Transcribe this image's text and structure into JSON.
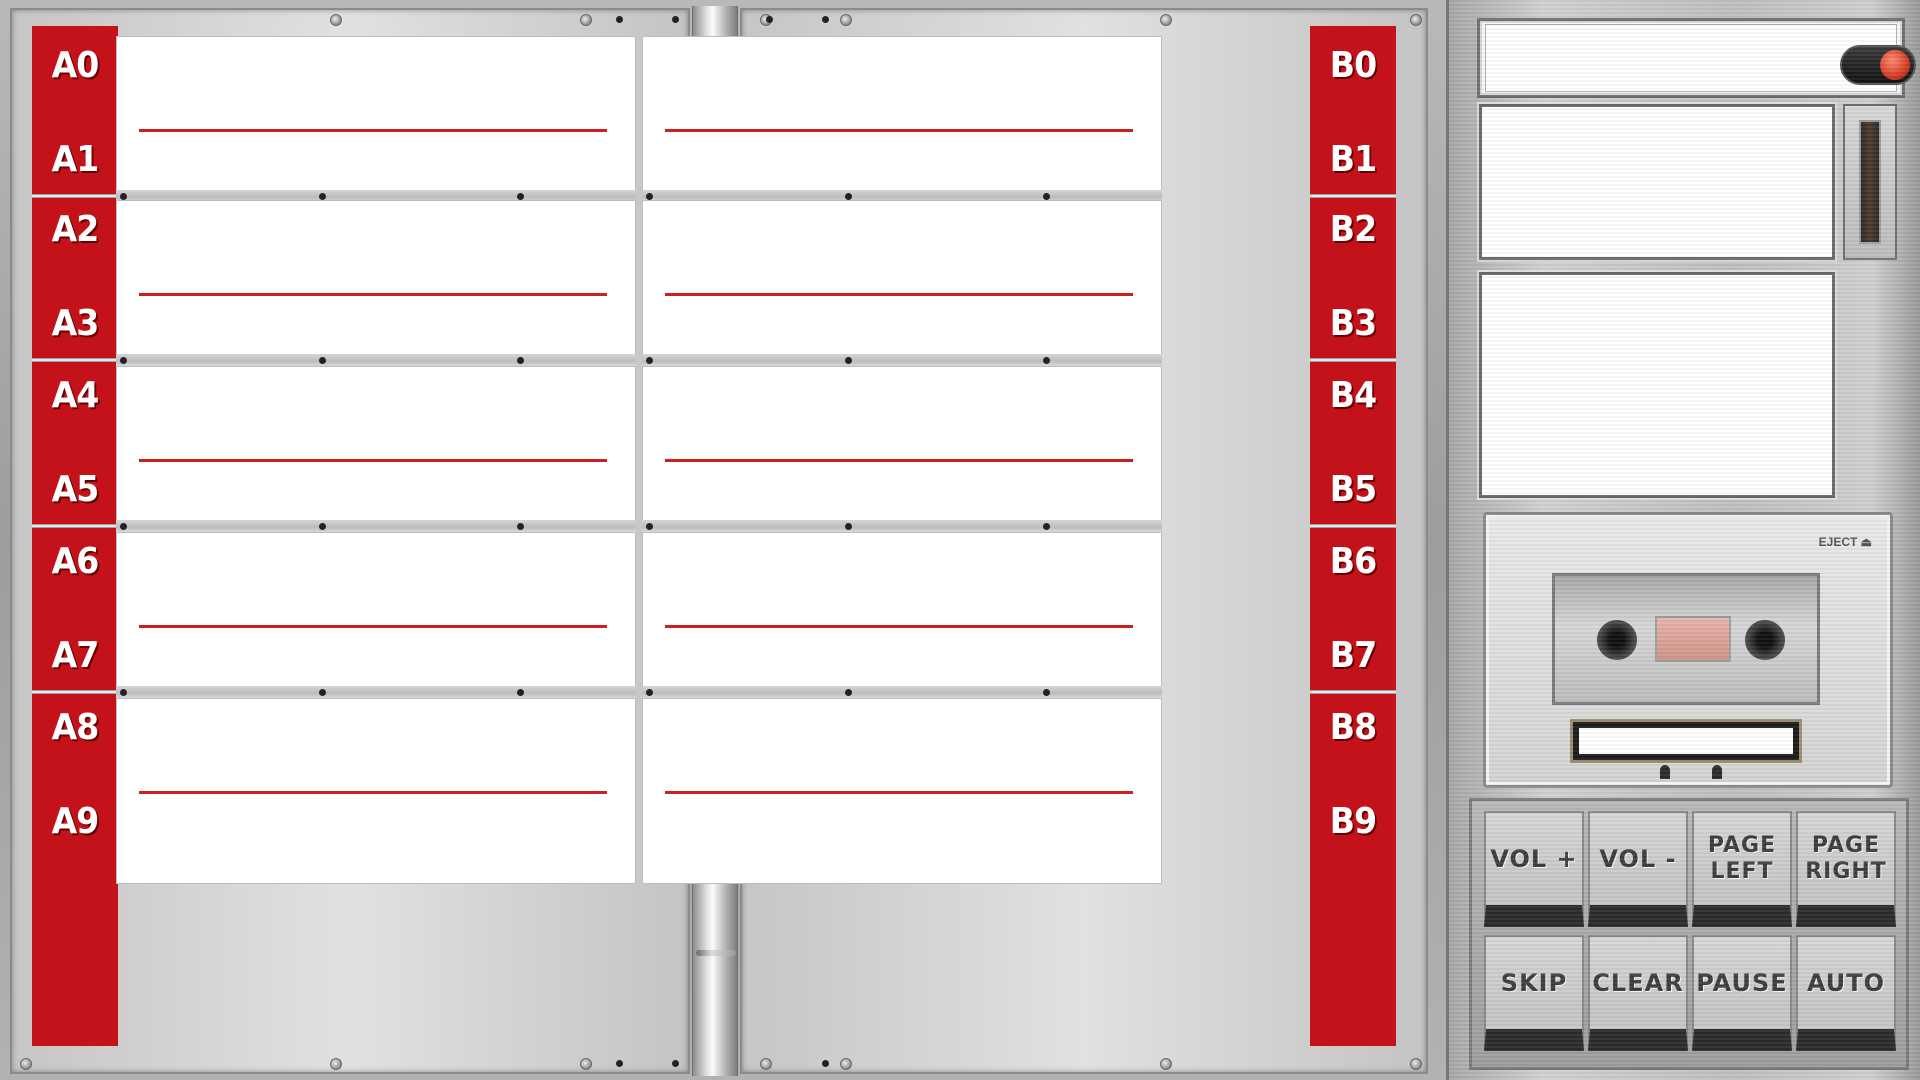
{
  "left_page": {
    "labels": [
      "A0",
      "A1",
      "A2",
      "A3",
      "A4",
      "A5",
      "A6",
      "A7",
      "A8",
      "A9"
    ]
  },
  "right_page": {
    "labels": [
      "B0",
      "B1",
      "B2",
      "B3",
      "B4",
      "B5",
      "B6",
      "B7",
      "B8",
      "B9"
    ]
  },
  "console": {
    "deck": {
      "eject_label": "EJECT ⏏"
    },
    "buttons": [
      {
        "name": "vol-up-button",
        "label": "VOL +"
      },
      {
        "name": "vol-down-button",
        "label": "VOL -"
      },
      {
        "name": "page-left-button",
        "label": "PAGE\nLEFT"
      },
      {
        "name": "page-right-button",
        "label": "PAGE\nRIGHT"
      },
      {
        "name": "skip-button",
        "label": "SKIP"
      },
      {
        "name": "clear-button",
        "label": "CLEAR"
      },
      {
        "name": "pause-button",
        "label": "PAUSE"
      },
      {
        "name": "auto-button",
        "label": "AUTO"
      }
    ],
    "power_toggle_state": "on"
  },
  "colors": {
    "selection_red": "#c4121a",
    "card_line_red": "#cf1f1f",
    "toggle_red": "#d53a22"
  }
}
